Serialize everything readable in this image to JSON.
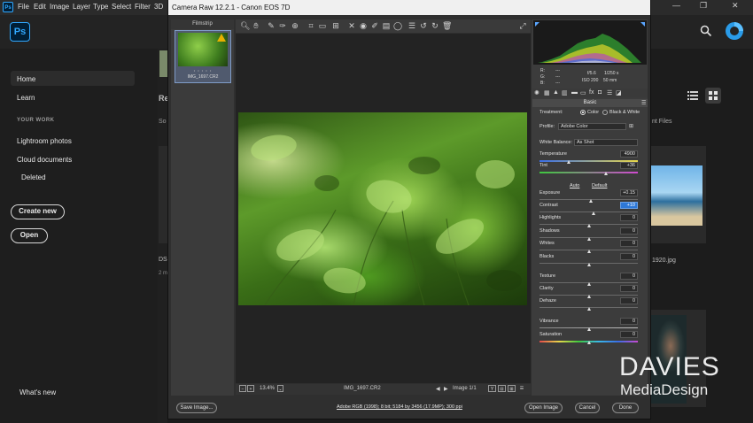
{
  "ps": {
    "menus": [
      "File",
      "Edit",
      "Image",
      "Layer",
      "Type",
      "Select",
      "Filter",
      "3D"
    ],
    "window_controls": [
      "—",
      "❐",
      "✕"
    ],
    "logo": "Ps",
    "nav": {
      "home": "Home",
      "learn": "Learn",
      "section": "YOUR WORK",
      "lightroom": "Lightroom photos",
      "cloud": "Cloud documents",
      "deleted": "Deleted",
      "whats_new": "What's new"
    },
    "buttons": {
      "create_new": "Create new",
      "open": "Open"
    },
    "bg_texts": {
      "recent": "Re",
      "sort": "So",
      "filename": "DS",
      "time": "2 m",
      "files": "nt Files",
      "jpg": "1920.jpg"
    }
  },
  "acr": {
    "title": "Camera Raw 12.2.1  -  Canon EOS 7D",
    "filmstrip_label": "Filmstrip",
    "thumb_name": "IMG_1697.CR2",
    "thumb_stars": "• • • • •",
    "zoom": "13.4%",
    "zoom_minus": "−",
    "zoom_plus": "+",
    "zoom_drop": "⌄",
    "filename": "IMG_1697.CR2",
    "image_counter": "Image 1/1",
    "view_icons": [
      "Y",
      "⊟",
      "⊞",
      "☰"
    ],
    "workflow": "Adobe RGB (1998); 8 bit; 5184 by 3456 (17.9MP); 300 ppi",
    "buttons": {
      "save": "Save Image...",
      "open": "Open Image",
      "cancel": "Cancel",
      "done": "Done"
    },
    "readout": {
      "r": "R:",
      "g": "G:",
      "b": "B:",
      "dash": "---",
      "aperture": "f/5.6",
      "shutter": "1/250 s",
      "iso": "ISO 200",
      "focal": "50 mm"
    },
    "panel": {
      "basic": "Basic",
      "treatment": "Treatment:",
      "color": "Color",
      "bw": "Black & White",
      "profile": "Profile:",
      "profile_value": "Adobe Color",
      "wb": "White Balance:",
      "wb_value": "As Shot",
      "auto": "Auto",
      "default": "Default"
    },
    "sliders": [
      {
        "label": "Temperature",
        "value": "4900",
        "level": 0.3
      },
      {
        "label": "Tint",
        "value": "+36",
        "level": 0.68
      },
      {
        "label": "Exposure",
        "value": "+0.15",
        "level": 0.52
      },
      {
        "label": "Contrast",
        "value": "+10",
        "level": 0.55
      },
      {
        "label": "Highlights",
        "value": "0",
        "level": 0.5
      },
      {
        "label": "Shadows",
        "value": "0",
        "level": 0.5
      },
      {
        "label": "Whites",
        "value": "0",
        "level": 0.5
      },
      {
        "label": "Blacks",
        "value": "0",
        "level": 0.5
      },
      {
        "label": "Texture",
        "value": "0",
        "level": 0.5
      },
      {
        "label": "Clarity",
        "value": "0",
        "level": 0.5
      },
      {
        "label": "Dehaze",
        "value": "0",
        "level": 0.5
      },
      {
        "label": "Vibrance",
        "value": "0",
        "level": 0.5
      },
      {
        "label": "Saturation",
        "value": "0",
        "level": 0.5
      }
    ]
  },
  "watermark": {
    "line1": "DAVIES",
    "line2": "MediaDesign"
  }
}
